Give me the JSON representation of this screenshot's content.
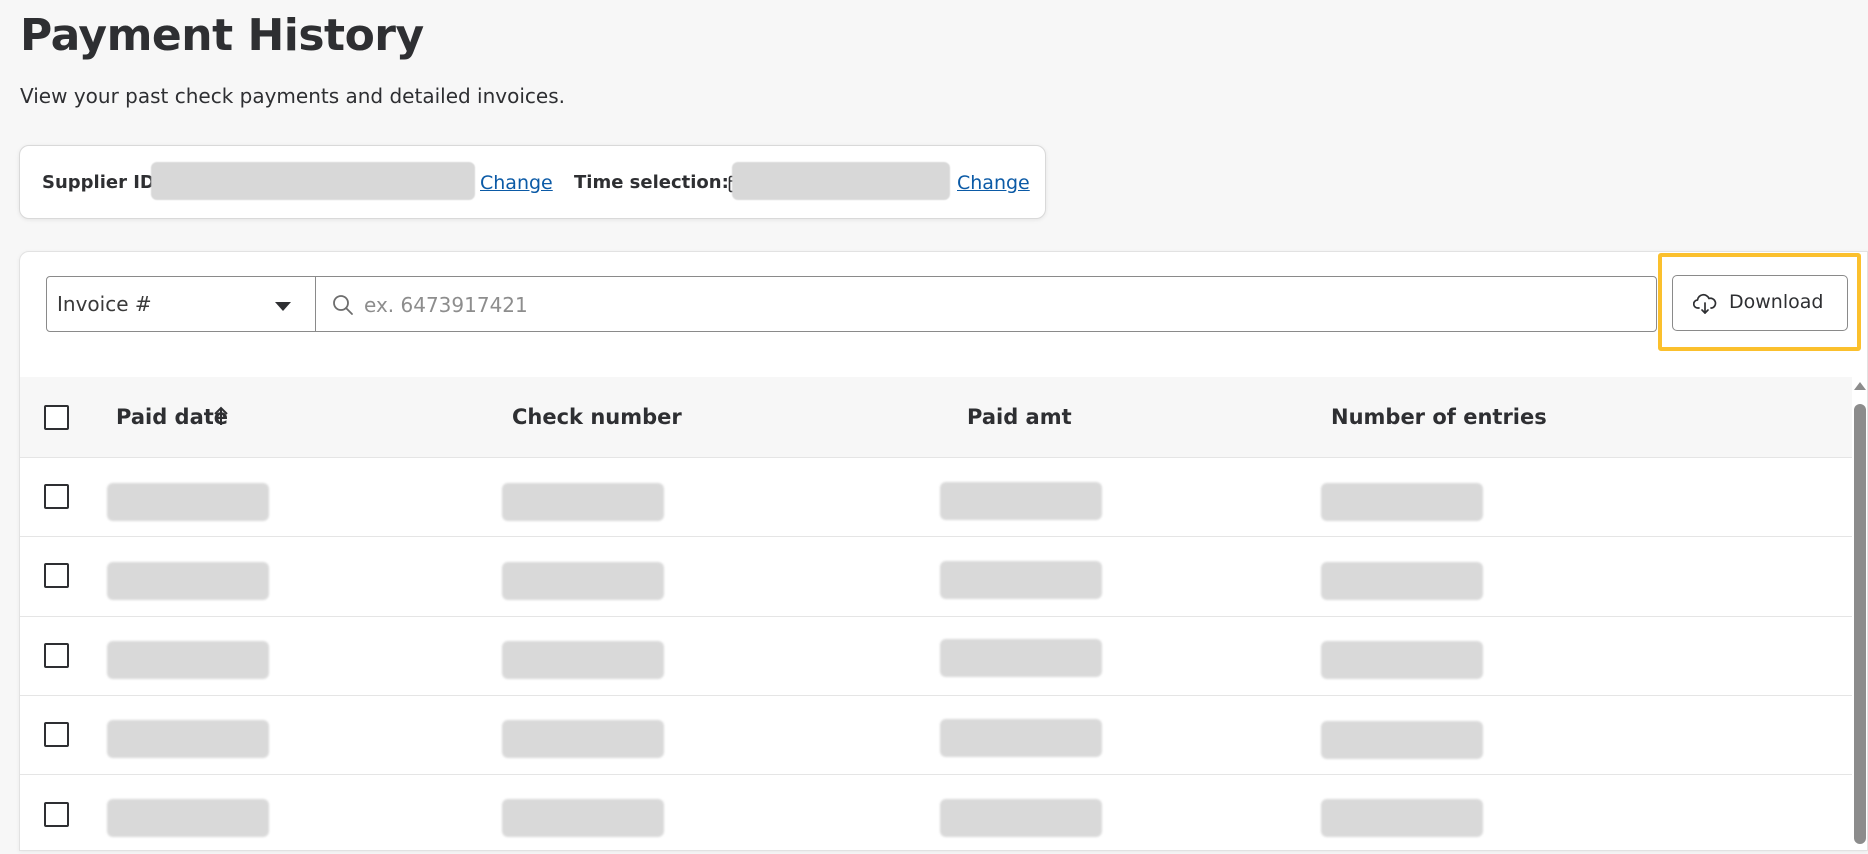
{
  "page": {
    "title": "Payment History",
    "subtitle": "View your past check payments and detailed invoices."
  },
  "filters": {
    "supplier_label": "Supplier ID:",
    "supplier_change": "Change",
    "time_label": "Time selection:",
    "time_change": "Change"
  },
  "search": {
    "type_selected": "Invoice #",
    "placeholder": "ex. 6473917421"
  },
  "toolbar": {
    "download_label": "Download",
    "highlight_color": "#fbc02d"
  },
  "table": {
    "columns": [
      "Paid date",
      "Check number",
      "Paid amt",
      "Number of entries"
    ],
    "sort_icon": "arrow-up-icon",
    "row_count_visible": 5
  },
  "colors": {
    "link": "#0b5aa6",
    "text": "#2e2f32",
    "background": "#f7f7f7"
  }
}
